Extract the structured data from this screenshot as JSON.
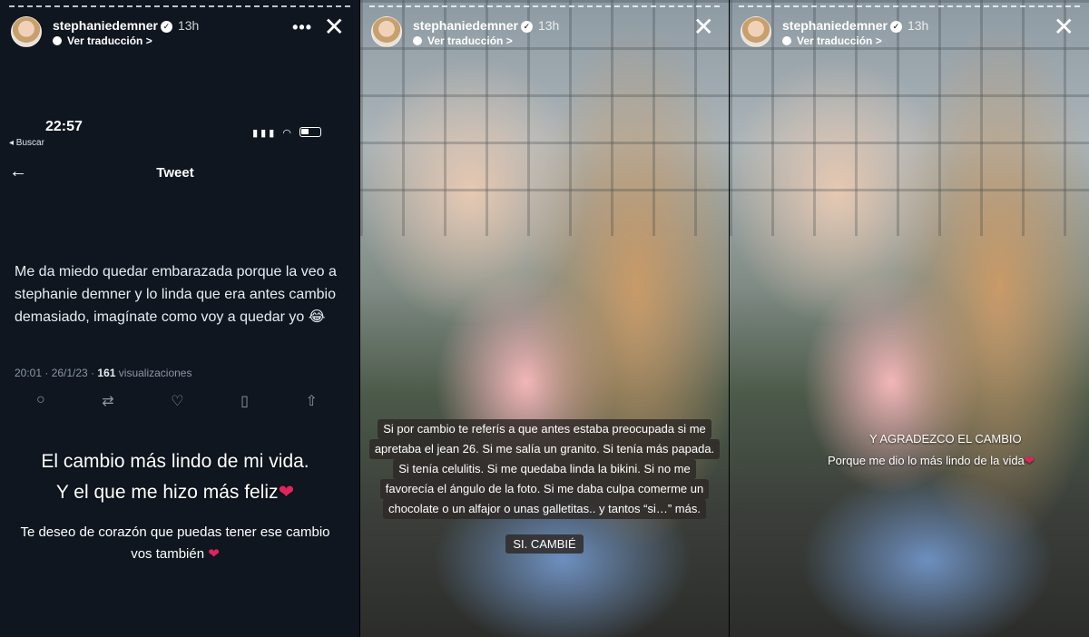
{
  "story": {
    "username": "stephaniedemner",
    "time": "13h",
    "translate": "Ver traducción >"
  },
  "panel1": {
    "phone_time": "22:57",
    "buscar": "◂ Buscar",
    "tweet_header": "Tweet",
    "tweet_text": "Me da miedo quedar embarazada porque la veo a stephanie demner y lo linda que era antes cambio demasiado, imagínate como voy a quedar yo 😂",
    "meta_date": "20:01 · 26/1/23 · ",
    "meta_views": "161",
    "meta_views_label": " visualizaciones",
    "caption_line1": "El cambio más lindo de mi vida.",
    "caption_line2": "Y el que me hizo más feliz",
    "caption_small_1": "Te deseo de corazón que puedas tener ese cambio",
    "caption_small_2": "vos también"
  },
  "panel2": {
    "lines": [
      "Si por cambio te referís a que antes estaba preocupada si me",
      "apretaba el jean 26. Si me salía un granito. Si tenía más papada.",
      "Si tenía celulitis. Si me quedaba linda la bikini. Si no me",
      "favorecía el ángulo de la foto. Si me daba culpa comerme un",
      "chocolate o un alfajor o unas galletitas.. y tantos “si…” más."
    ],
    "si_cambie": "SI. CAMBIÉ"
  },
  "panel3": {
    "line1": "Y AGRADEZCO EL CAMBIO",
    "line2": "Porque me dio lo más lindo de la vida"
  },
  "colors": {
    "panel1_bg": "#0f1620",
    "heart": "#e0245e"
  }
}
